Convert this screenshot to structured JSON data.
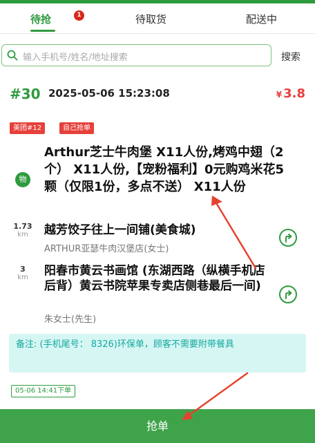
{
  "tabs": [
    {
      "label": "待抢",
      "badge": "1"
    },
    {
      "label": "待取货"
    },
    {
      "label": "配送中"
    }
  ],
  "search": {
    "placeholder": "输入手机号/姓名/地址搜索",
    "button": "搜索"
  },
  "order": {
    "number": "#30",
    "time": "2025-05-06 15:23:08",
    "price_symbol": "¥",
    "price": "3.8",
    "tags": [
      "美团#12",
      "自己抢单"
    ],
    "goods_icon": "物",
    "goods": "Arthur芝士牛肉堡 X11人份,烤鸡中翅（2个） X11人份,【宠粉福利】0元购鸡米花5颗（仅限1份，多点不送） X11人份",
    "shop": {
      "distance": "1.73",
      "unit": "km",
      "name": "越芳饺子往上一间铺(美食城)",
      "sub": "ARTHUR亚瑟牛肉汉堡店(女士)"
    },
    "customer": {
      "distance": "3",
      "unit": "km",
      "address": "阳春市黄云书画馆 (东湖西路（纵横手机店后背）黄云书院苹果专卖店侧巷最后一间)",
      "name": "朱女士(先生)"
    },
    "remark": "备注: (手机尾号： 8326)环保单，顾客不需要附带餐具",
    "time_tag": "05-06 14:41下单"
  },
  "action": {
    "grab": "抢单"
  },
  "colors": {
    "brand": "#2e9b3e",
    "price": "#e6403a",
    "badge": "#d9261c",
    "remark_bg": "#d6f6f4",
    "remark_text": "#13a89e",
    "annotation": "#e5432f"
  },
  "icons": {
    "search": "search-icon",
    "nav": "navigation-icon",
    "annotation": "red-arrow-annotation"
  }
}
